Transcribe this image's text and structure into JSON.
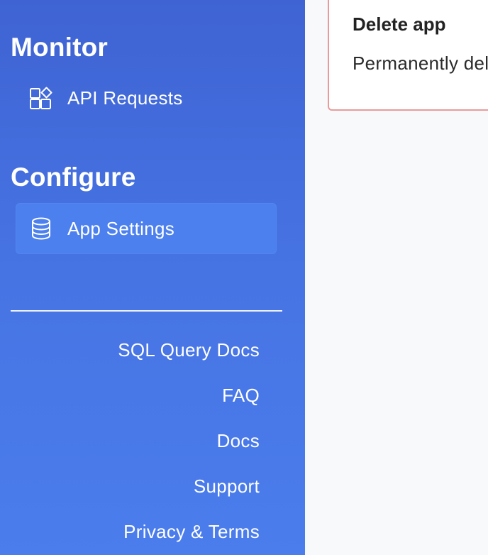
{
  "sidebar": {
    "sections": [
      {
        "heading": "Monitor",
        "items": [
          {
            "label": "API Requests",
            "icon": "widgets-icon",
            "active": false
          }
        ]
      },
      {
        "heading": "Configure",
        "items": [
          {
            "label": "App Settings",
            "icon": "database-icon",
            "active": true
          }
        ]
      }
    ],
    "footer_links": [
      {
        "label": "SQL Query Docs"
      },
      {
        "label": "FAQ"
      },
      {
        "label": "Docs"
      },
      {
        "label": "Support"
      },
      {
        "label": "Privacy & Terms"
      }
    ]
  },
  "main": {
    "danger_card": {
      "title": "Delete app",
      "description": "Permanently delete this app"
    }
  },
  "colors": {
    "sidebar_top": "#3f63d3",
    "sidebar_bottom": "#4b7ded",
    "active_item": "#4c80ee",
    "danger_border": "#ea9a9a",
    "main_bg": "#f8f9fb"
  }
}
